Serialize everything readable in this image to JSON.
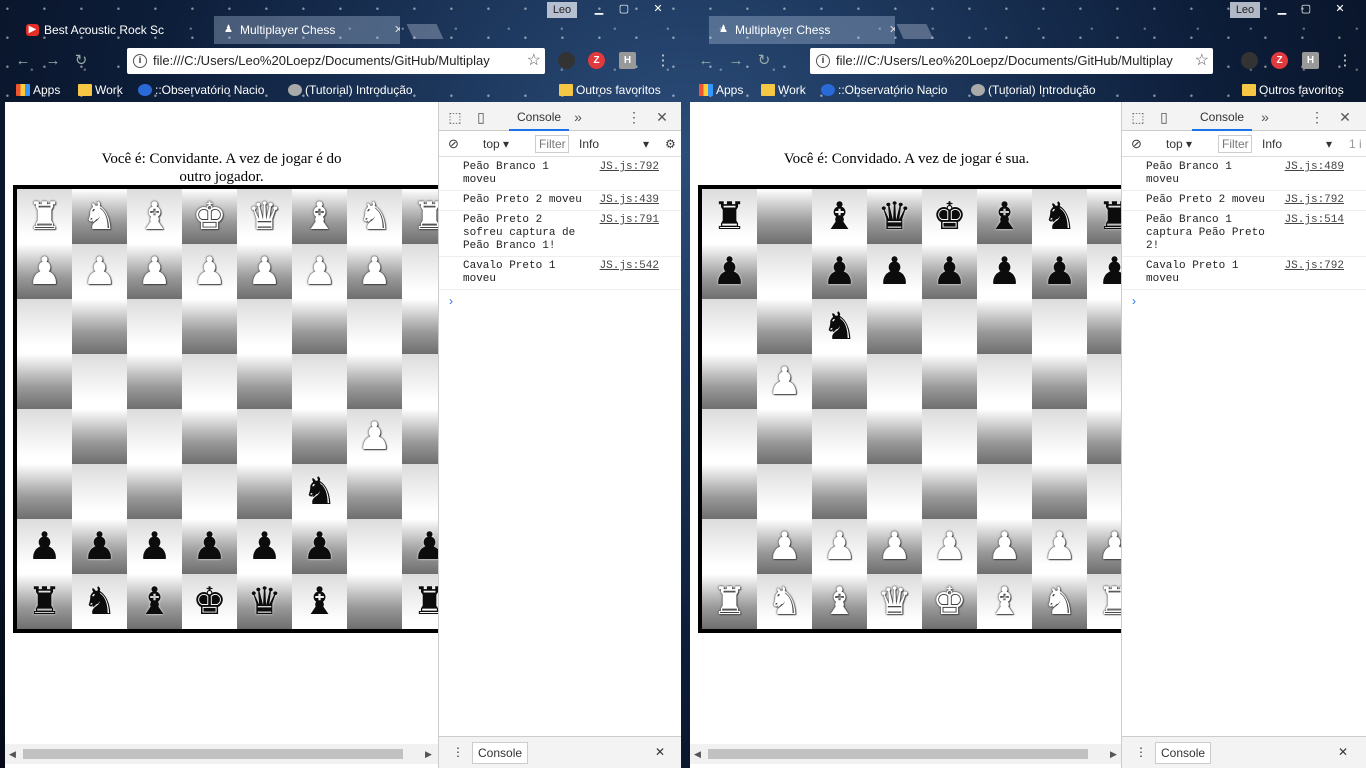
{
  "left": {
    "tabs": [
      {
        "title": "Best Acoustic Rock Sc",
        "icon": "youtube-icon",
        "close": "✕"
      },
      {
        "title": "Multiplayer Chess",
        "icon": "page-icon",
        "close": "✕"
      }
    ],
    "user": "Leo",
    "url": "file:///C:/Users/Leo%20Loepz/Documents/GitHub/Multiplay",
    "bookmarks": [
      "Apps",
      "Work",
      "::Observatório Nacio",
      "(Tutorial) Introdução",
      "Outros favoritos"
    ],
    "status": "Você é: Convidante. A vez de jogar é do outro jogador.",
    "board": [
      [
        "wr",
        "wn",
        "wb",
        "wk",
        "wq",
        "wb",
        "wn",
        "wr"
      ],
      [
        "wp",
        "wp",
        "wp",
        "wp",
        "wp",
        "wp",
        "wp",
        ""
      ],
      [
        "",
        "",
        "",
        "",
        "",
        "",
        "",
        ""
      ],
      [
        "",
        "",
        "",
        "",
        "",
        "",
        "",
        ""
      ],
      [
        "",
        "",
        "",
        "",
        "",
        "",
        "wp",
        ""
      ],
      [
        "",
        "",
        "",
        "",
        "",
        "bn",
        "",
        ""
      ],
      [
        "bp",
        "bp",
        "bp",
        "bp",
        "bp",
        "bp",
        "",
        "bp"
      ],
      [
        "br",
        "bn",
        "bb",
        "bk",
        "bq",
        "bb",
        "",
        "br"
      ]
    ],
    "devtools": {
      "tab": "Console",
      "context": "top",
      "filter_placeholder": "Filter",
      "level": "Info",
      "messages": [
        {
          "text": "Peão Branco 1 moveu",
          "source": "JS.js:792"
        },
        {
          "text": "Peão Preto 2 moveu",
          "source": "JS.js:439"
        },
        {
          "text": "Peão Preto 2 sofreu captura de Peão Branco 1!",
          "source": "JS.js:791"
        },
        {
          "text": "Cavalo Preto 1 moveu",
          "source": "JS.js:542"
        }
      ],
      "drawer_tab": "Console"
    }
  },
  "right": {
    "tabs": [
      {
        "title": "Multiplayer Chess",
        "icon": "page-icon",
        "close": "✕"
      }
    ],
    "user": "Leo",
    "url": "file:///C:/Users/Leo%20Loepz/Documents/GitHub/Multiplay",
    "bookmarks": [
      "Apps",
      "Work",
      "::Observatório Nacio",
      "(Tutorial) Introdução",
      "Outros favoritos"
    ],
    "status": "Você é: Convidado. A vez de jogar é sua.",
    "board": [
      [
        "br",
        "",
        "bb",
        "bq",
        "bk",
        "bb",
        "bn",
        "br"
      ],
      [
        "bp",
        "",
        "bp",
        "bp",
        "bp",
        "bp",
        "bp",
        "bp"
      ],
      [
        "",
        "",
        "bn",
        "",
        "",
        "",
        "",
        ""
      ],
      [
        "",
        "wp",
        "",
        "",
        "",
        "",
        "",
        ""
      ],
      [
        "",
        "",
        "",
        "",
        "",
        "",
        "",
        ""
      ],
      [
        "",
        "",
        "",
        "",
        "",
        "",
        "",
        ""
      ],
      [
        "",
        "wp",
        "wp",
        "wp",
        "wp",
        "wp",
        "wp",
        "wp"
      ],
      [
        "wr",
        "wn",
        "wb",
        "wq",
        "wk",
        "wb",
        "wn",
        "wr"
      ]
    ],
    "devtools": {
      "tab": "Console",
      "context": "top",
      "filter_placeholder": "Filter",
      "level": "Info",
      "extra": "1 i",
      "messages": [
        {
          "text": "Peão Branco 1 moveu",
          "source": "JS.js:489"
        },
        {
          "text": "Peão Preto 2 moveu",
          "source": "JS.js:792"
        },
        {
          "text": "Peão Branco 1 captura Peão Preto 2!",
          "source": "JS.js:514"
        },
        {
          "text": "Cavalo Preto 1 moveu",
          "source": "JS.js:792"
        }
      ],
      "drawer_tab": "Console"
    }
  },
  "piece_glyphs": {
    "wr": "♜",
    "wn": "♞",
    "wb": "♝",
    "wq": "♛",
    "wk": "♚",
    "wp": "♟",
    "br": "♜",
    "bn": "♞",
    "bb": "♝",
    "bq": "♛",
    "bk": "♚",
    "bp": "♟"
  },
  "colors": {
    "accent": "#1a73e8",
    "youtube": "#e52d27",
    "folder": "#f6c744"
  }
}
